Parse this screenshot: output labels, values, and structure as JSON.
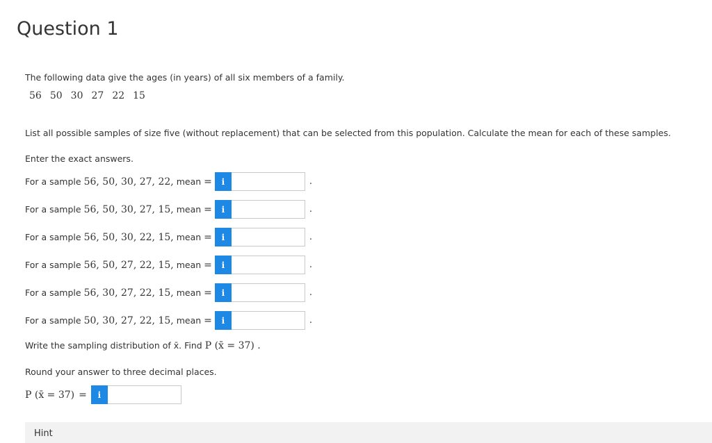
{
  "question": {
    "title": "Question 1",
    "intro": "The following data give the ages (in years) of all six members of a family.",
    "ages": [
      "56",
      "50",
      "30",
      "27",
      "22",
      "15"
    ],
    "instruction": "List all possible samples of size five (without replacement) that can be selected from this population. Calculate the mean for each of these samples.",
    "enter_exact": "Enter the exact answers.",
    "samples": [
      {
        "prefix": "For a sample",
        "values": "56, 50, 30, 27, 22,",
        "suffix": "mean",
        "eq": "=",
        "info": "i",
        "answer": "",
        "period": "."
      },
      {
        "prefix": "For a sample",
        "values": "56, 50, 30, 27, 15,",
        "suffix": "mean",
        "eq": "=",
        "info": "i",
        "answer": "",
        "period": "."
      },
      {
        "prefix": "For a sample",
        "values": "56, 50, 30, 22, 15,",
        "suffix": "mean",
        "eq": "=",
        "info": "i",
        "answer": "",
        "period": "."
      },
      {
        "prefix": "For a sample",
        "values": "56, 50, 27, 22, 15,",
        "suffix": "mean",
        "eq": "=",
        "info": "i",
        "answer": "",
        "period": "."
      },
      {
        "prefix": "For a sample",
        "values": "56, 30, 27, 22, 15,",
        "suffix": "mean",
        "eq": "=",
        "info": "i",
        "answer": "",
        "period": "."
      },
      {
        "prefix": "For a sample",
        "values": "50, 30, 27, 22, 15,",
        "suffix": "mean",
        "eq": "=",
        "info": "i",
        "answer": "",
        "period": "."
      }
    ],
    "sampling_text": "Write the sampling distribution of x̄. Find",
    "sampling_expr": "P (x̄ = 37) .",
    "round_text": "Round your answer to three decimal places.",
    "prob_label": "P (x̄ = 37)",
    "prob_eq": "=",
    "prob_info": "i",
    "prob_answer": "",
    "hint": "Hint"
  },
  "colors": {
    "info_button": "#1e88e5",
    "hint_bg": "#f2f2f2"
  }
}
